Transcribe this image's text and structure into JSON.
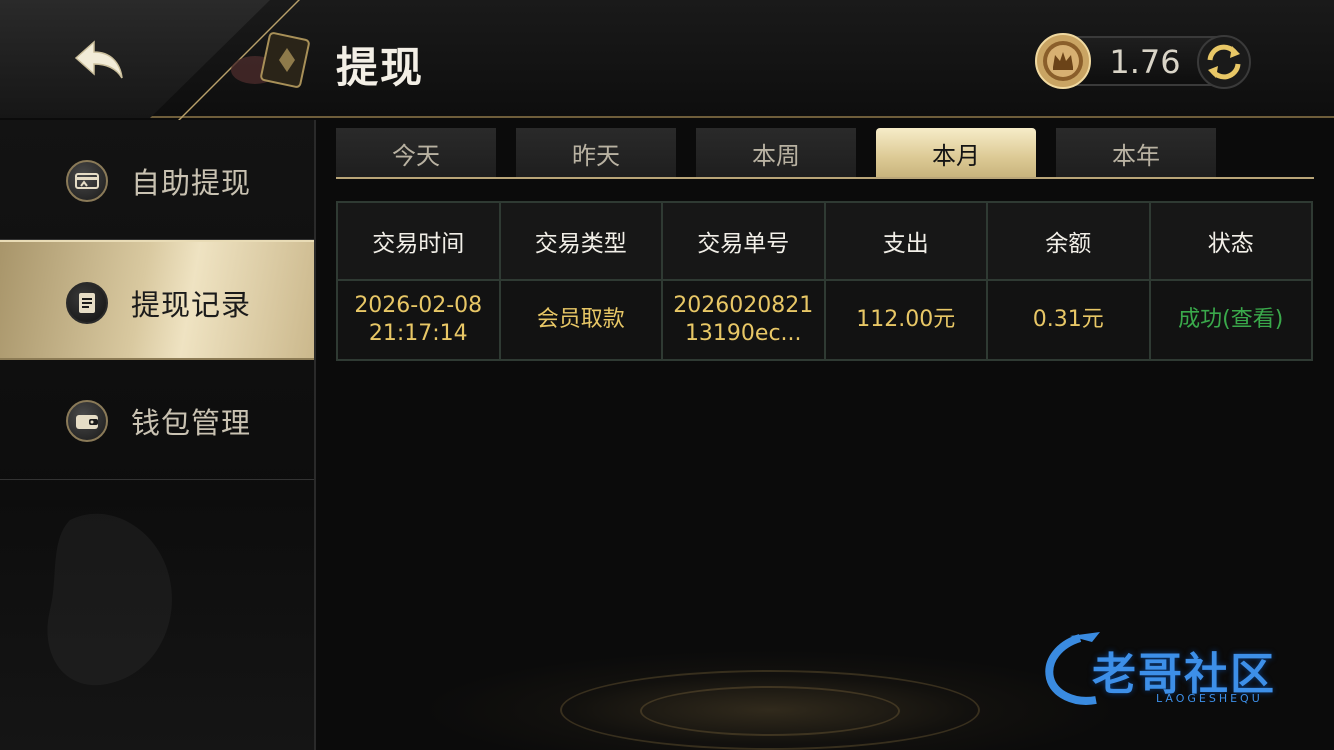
{
  "header": {
    "title": "提现",
    "balance": "1.76",
    "back_icon": "back-arrow-icon",
    "refresh_icon": "refresh-icon",
    "currency_icon": "crown-chip-icon"
  },
  "sidebar": {
    "items": [
      {
        "label": "自助提现",
        "icon": "card-withdraw-icon",
        "active": false
      },
      {
        "label": "提现记录",
        "icon": "record-list-icon",
        "active": true
      },
      {
        "label": "钱包管理",
        "icon": "wallet-icon",
        "active": false
      }
    ]
  },
  "tabs": [
    {
      "label": "今天",
      "active": false
    },
    {
      "label": "昨天",
      "active": false
    },
    {
      "label": "本周",
      "active": false
    },
    {
      "label": "本月",
      "active": true
    },
    {
      "label": "本年",
      "active": false
    }
  ],
  "table": {
    "headers": [
      "交易时间",
      "交易类型",
      "交易单号",
      "支出",
      "余额",
      "状态"
    ],
    "rows": [
      {
        "time": "2026-02-08 21:17:14",
        "type": "会员取款",
        "order_no": "202602082113190ec...",
        "amount": "112.00元",
        "balance": "0.31元",
        "status": "成功(查看)"
      }
    ]
  },
  "watermark": {
    "text": "老哥社区",
    "subtext": "LAOGESHEQU"
  },
  "colors": {
    "gold": "#d9c9a0",
    "value_text": "#e8c766",
    "success": "#3aa94b"
  }
}
